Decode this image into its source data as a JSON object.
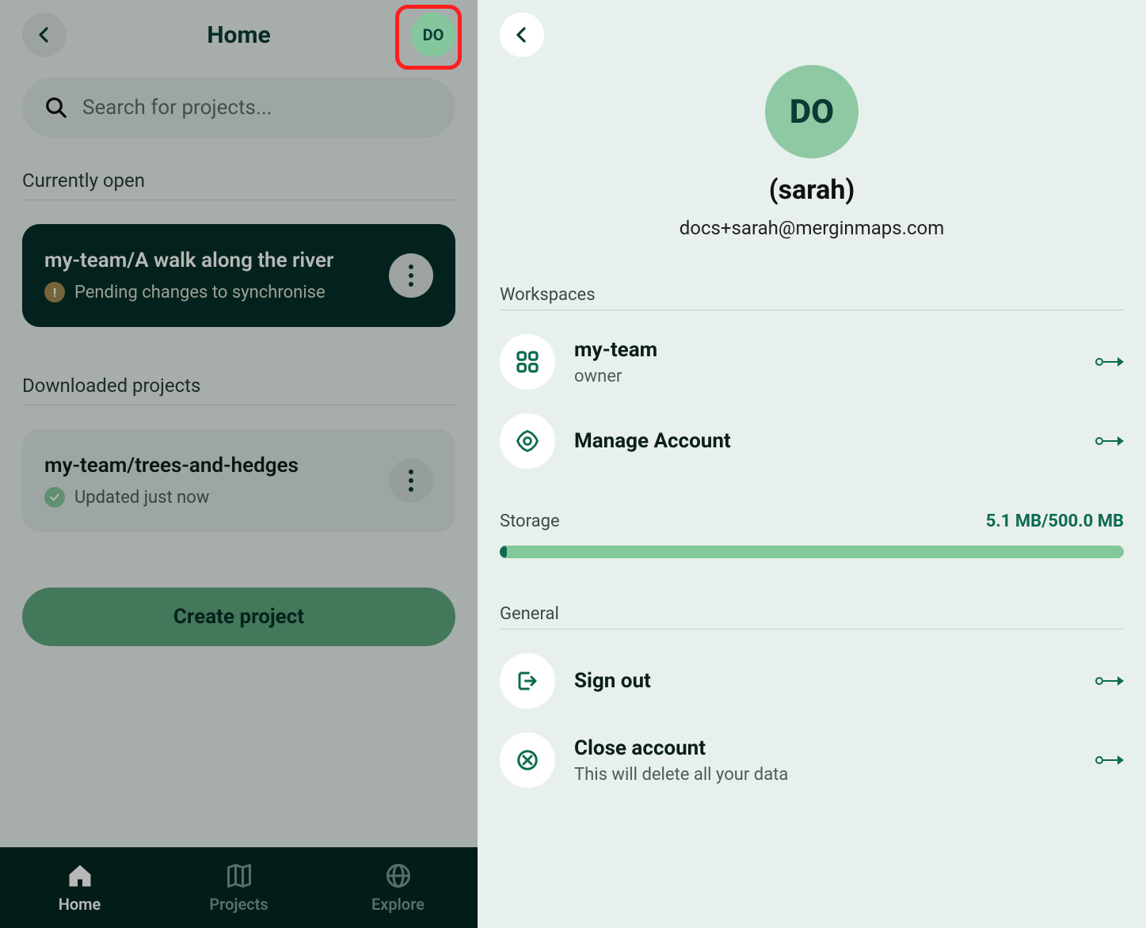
{
  "left": {
    "title": "Home",
    "avatar_initials": "DO",
    "search_placeholder": "Search for projects...",
    "section_current": "Currently open",
    "section_downloaded": "Downloaded projects",
    "current_project": {
      "name": "my-team/A walk along the river",
      "status": "Pending changes to synchronise"
    },
    "downloaded_project": {
      "name": "my-team/trees-and-hedges",
      "status": "Updated just now"
    },
    "create_label": "Create project",
    "nav": {
      "home": "Home",
      "projects": "Projects",
      "explore": "Explore"
    }
  },
  "right": {
    "avatar_initials": "DO",
    "username": "(sarah)",
    "email": "docs+sarah@merginmaps.com",
    "workspaces_heading": "Workspaces",
    "workspace": {
      "name": "my-team",
      "role": "owner"
    },
    "manage_label": "Manage Account",
    "storage_label": "Storage",
    "storage_value": "5.1 MB/500.0 MB",
    "general_heading": "General",
    "signout_label": "Sign out",
    "close_label": "Close account",
    "close_sub": "This will delete all your data"
  }
}
